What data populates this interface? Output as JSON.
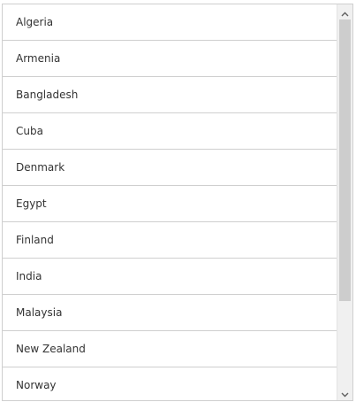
{
  "listbox": {
    "items": [
      {
        "label": "Algeria"
      },
      {
        "label": "Armenia"
      },
      {
        "label": "Bangladesh"
      },
      {
        "label": "Cuba"
      },
      {
        "label": "Denmark"
      },
      {
        "label": "Egypt"
      },
      {
        "label": "Finland"
      },
      {
        "label": "India"
      },
      {
        "label": "Malaysia"
      },
      {
        "label": "New Zealand"
      },
      {
        "label": "Norway"
      }
    ],
    "scrollbar": {
      "position": 0,
      "visible_fraction": 0.77,
      "up_icon": "chevron-up-icon",
      "down_icon": "chevron-down-icon"
    }
  }
}
